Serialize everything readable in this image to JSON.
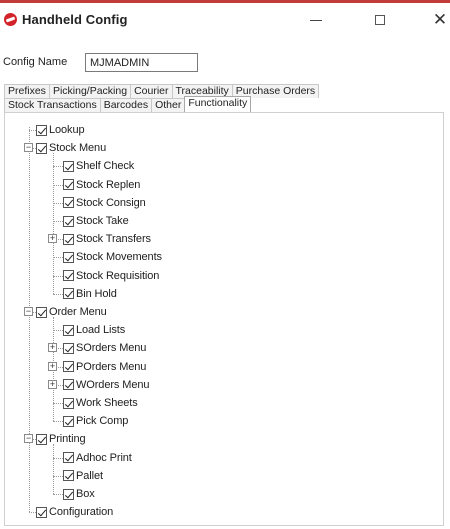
{
  "window": {
    "title": "Handheld Config",
    "controls": {
      "minimize": "—",
      "maximize": "□",
      "close": "✕"
    }
  },
  "config_name": {
    "label": "Config Name",
    "value": "MJMADMIN"
  },
  "tabs": {
    "row1": [
      "Prefixes",
      "Picking/Packing",
      "Courier",
      "Traceability",
      "Purchase Orders"
    ],
    "row2": [
      "Stock Transactions",
      "Barcodes",
      "Other",
      "Functionality"
    ],
    "active": "Functionality"
  },
  "tree": [
    {
      "label": "Lookup",
      "level": 0,
      "checked": true,
      "expander": ""
    },
    {
      "label": "Stock Menu",
      "level": 0,
      "checked": true,
      "expander": "−"
    },
    {
      "label": "Shelf Check",
      "level": 1,
      "checked": true,
      "expander": ""
    },
    {
      "label": "Stock Replen",
      "level": 1,
      "checked": true,
      "expander": ""
    },
    {
      "label": "Stock Consign",
      "level": 1,
      "checked": true,
      "expander": ""
    },
    {
      "label": "Stock Take",
      "level": 1,
      "checked": true,
      "expander": ""
    },
    {
      "label": "Stock Transfers",
      "level": 1,
      "checked": true,
      "expander": "+"
    },
    {
      "label": "Stock Movements",
      "level": 1,
      "checked": true,
      "expander": ""
    },
    {
      "label": "Stock Requisition",
      "level": 1,
      "checked": true,
      "expander": ""
    },
    {
      "label": "Bin Hold",
      "level": 1,
      "checked": true,
      "expander": ""
    },
    {
      "label": "Order Menu",
      "level": 0,
      "checked": true,
      "expander": "−"
    },
    {
      "label": "Load Lists",
      "level": 1,
      "checked": true,
      "expander": ""
    },
    {
      "label": "SOrders Menu",
      "level": 1,
      "checked": true,
      "expander": "+"
    },
    {
      "label": "POrders Menu",
      "level": 1,
      "checked": true,
      "expander": "+"
    },
    {
      "label": "WOrders Menu",
      "level": 1,
      "checked": true,
      "expander": "+"
    },
    {
      "label": "Work Sheets",
      "level": 1,
      "checked": true,
      "expander": ""
    },
    {
      "label": "Pick Comp",
      "level": 1,
      "checked": true,
      "expander": ""
    },
    {
      "label": "Printing",
      "level": 0,
      "checked": true,
      "expander": "−"
    },
    {
      "label": "Adhoc Print",
      "level": 1,
      "checked": true,
      "expander": ""
    },
    {
      "label": "Pallet",
      "level": 1,
      "checked": true,
      "expander": ""
    },
    {
      "label": "Box",
      "level": 1,
      "checked": true,
      "expander": ""
    },
    {
      "label": "Configuration",
      "level": 0,
      "checked": true,
      "expander": ""
    }
  ]
}
